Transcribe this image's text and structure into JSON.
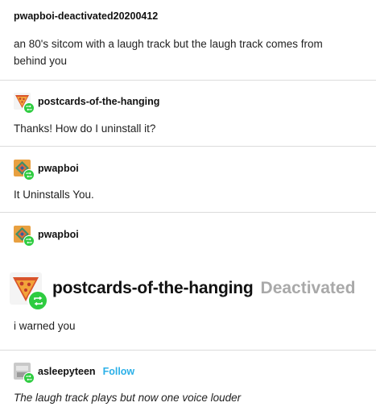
{
  "post1": {
    "username": "pwapboi-deactivated20200412",
    "text": "an 80's sitcom with a laugh track but the laugh track comes from behind you"
  },
  "reply1": {
    "username": "postcards-of-the-hanging",
    "avatar_icon": "pizza-slice-icon",
    "badge_icon": "reblog-icon",
    "text": "Thanks! How do I uninstall it?"
  },
  "reply2": {
    "username": "pwapboi",
    "avatar_icon": "diamond-avatar-icon",
    "badge_icon": "reblog-icon",
    "text": "It Uninstalls You."
  },
  "reply3": {
    "username": "pwapboi",
    "avatar_icon": "diamond-avatar-icon",
    "badge_icon": "reblog-icon",
    "big_username": "postcards-of-the-hanging",
    "big_status": "Deactivated",
    "big_avatar_icon": "pizza-slice-icon",
    "text": "i warned you"
  },
  "reply4": {
    "username": "asleepyteen",
    "avatar_icon": "grey-avatar-icon",
    "badge_icon": "reblog-icon",
    "follow_label": "Follow",
    "text": "The laugh track plays but now one voice louder"
  },
  "colors": {
    "badge": "#2ecc40",
    "follow": "#2bb0e8",
    "deactivated": "#a9a9a9",
    "divider": "#dcdcdc"
  }
}
